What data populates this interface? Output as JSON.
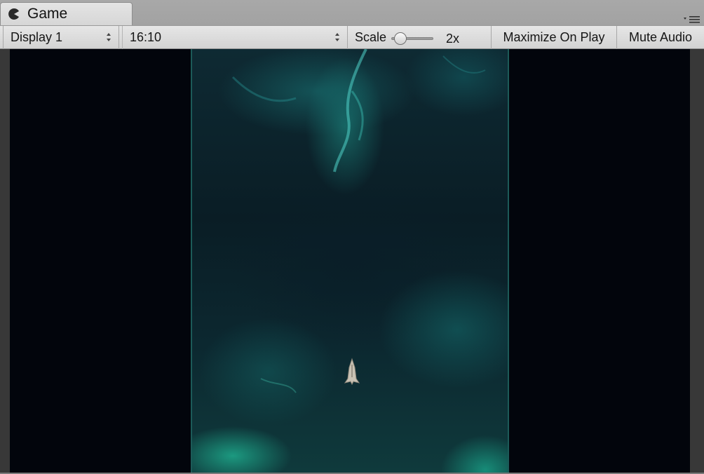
{
  "window": {
    "tab_label": "Game",
    "tab_icon": "pacman-icon",
    "menu_icon": "tab-menu-icon"
  },
  "toolbar": {
    "display_value": "Display 1",
    "aspect_value": "16:10",
    "scale_label": "Scale",
    "scale_value": "2x",
    "scale_level": 0.0,
    "maximize_label": "Maximize On Play",
    "mute_label": "Mute Audio"
  },
  "game": {
    "player_ship_icon": "spaceship-icon"
  },
  "colors": {
    "letterbox": "#02050c",
    "nebula": "#1aa08c",
    "toolbar": "#dcdcdc"
  }
}
